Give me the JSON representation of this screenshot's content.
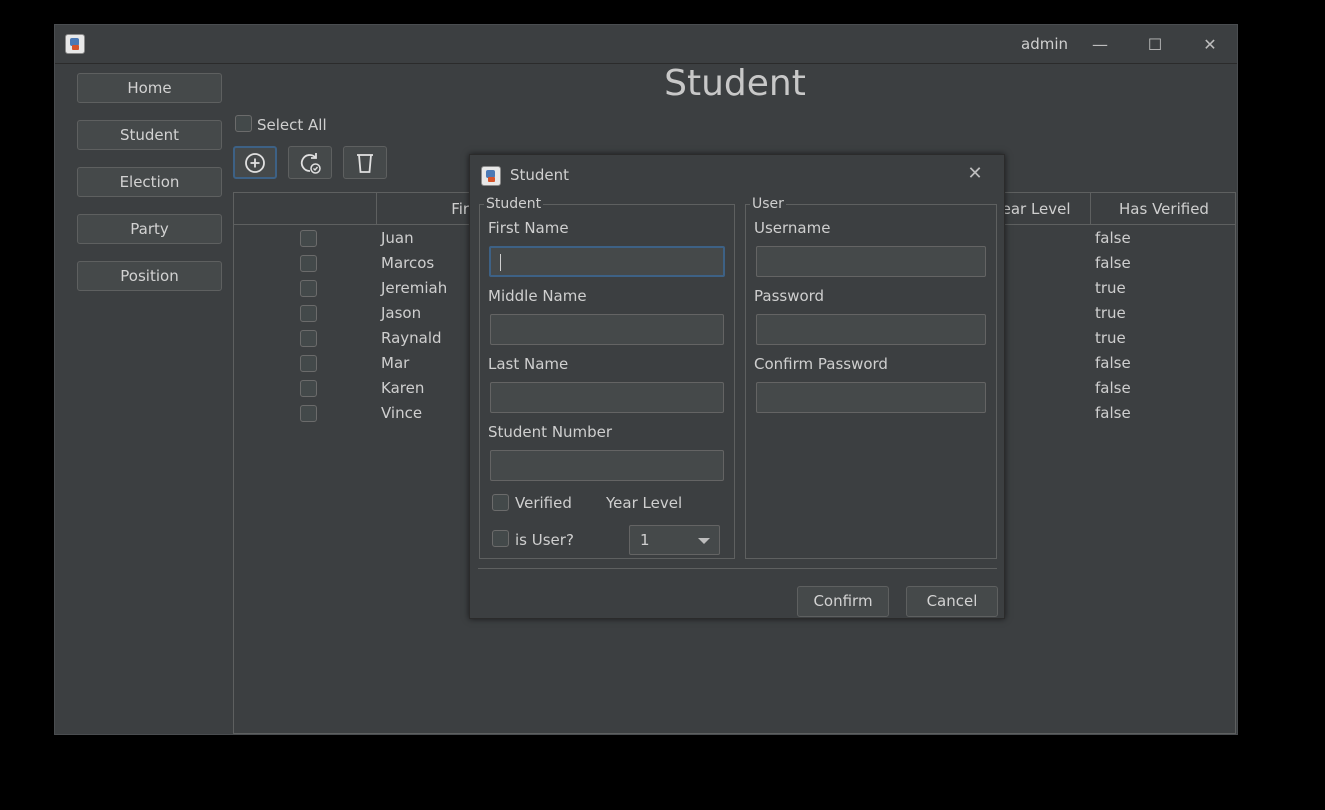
{
  "window": {
    "user": "admin",
    "controls": {
      "minimize": "—",
      "maximize": "☐",
      "close": "✕"
    }
  },
  "sidebar": {
    "items": [
      {
        "label": "Home"
      },
      {
        "label": "Student"
      },
      {
        "label": "Election"
      },
      {
        "label": "Party"
      },
      {
        "label": "Position"
      }
    ]
  },
  "page": {
    "title": "Student"
  },
  "toolbar": {
    "select_all_label": "Select All",
    "select_all_checked": false,
    "buttons": [
      {
        "icon": "add-circle-icon",
        "focused": true
      },
      {
        "icon": "refresh-check-icon"
      },
      {
        "icon": "trash-icon"
      }
    ]
  },
  "table": {
    "columns": [
      "",
      "First Name",
      "Year Level",
      "Has Verified"
    ],
    "rows": [
      {
        "first_name": "Juan",
        "has_verified": "false"
      },
      {
        "first_name": "Marcos",
        "has_verified": "false"
      },
      {
        "first_name": "Jeremiah",
        "has_verified": "true"
      },
      {
        "first_name": "Jason",
        "has_verified": "true"
      },
      {
        "first_name": "Raynald",
        "has_verified": "true"
      },
      {
        "first_name": "Mar",
        "has_verified": "false"
      },
      {
        "first_name": "Karen",
        "has_verified": "false"
      },
      {
        "first_name": "Vince",
        "has_verified": "false"
      }
    ]
  },
  "dialog": {
    "title": "Student",
    "close": "✕",
    "student_group": {
      "legend": "Student",
      "first_name_label": "First Name",
      "first_name_value": "",
      "middle_name_label": "Middle Name",
      "middle_name_value": "",
      "last_name_label": "Last Name",
      "last_name_value": "",
      "student_number_label": "Student Number",
      "student_number_value": "",
      "verified_label": "Verified",
      "verified_checked": false,
      "year_level_label": "Year Level",
      "year_level_value": "1",
      "is_user_label": "is User?",
      "is_user_checked": false
    },
    "user_group": {
      "legend": "User",
      "username_label": "Username",
      "username_value": "",
      "password_label": "Password",
      "password_value": "",
      "confirm_password_label": "Confirm Password",
      "confirm_password_value": ""
    },
    "confirm_label": "Confirm",
    "cancel_label": "Cancel"
  }
}
